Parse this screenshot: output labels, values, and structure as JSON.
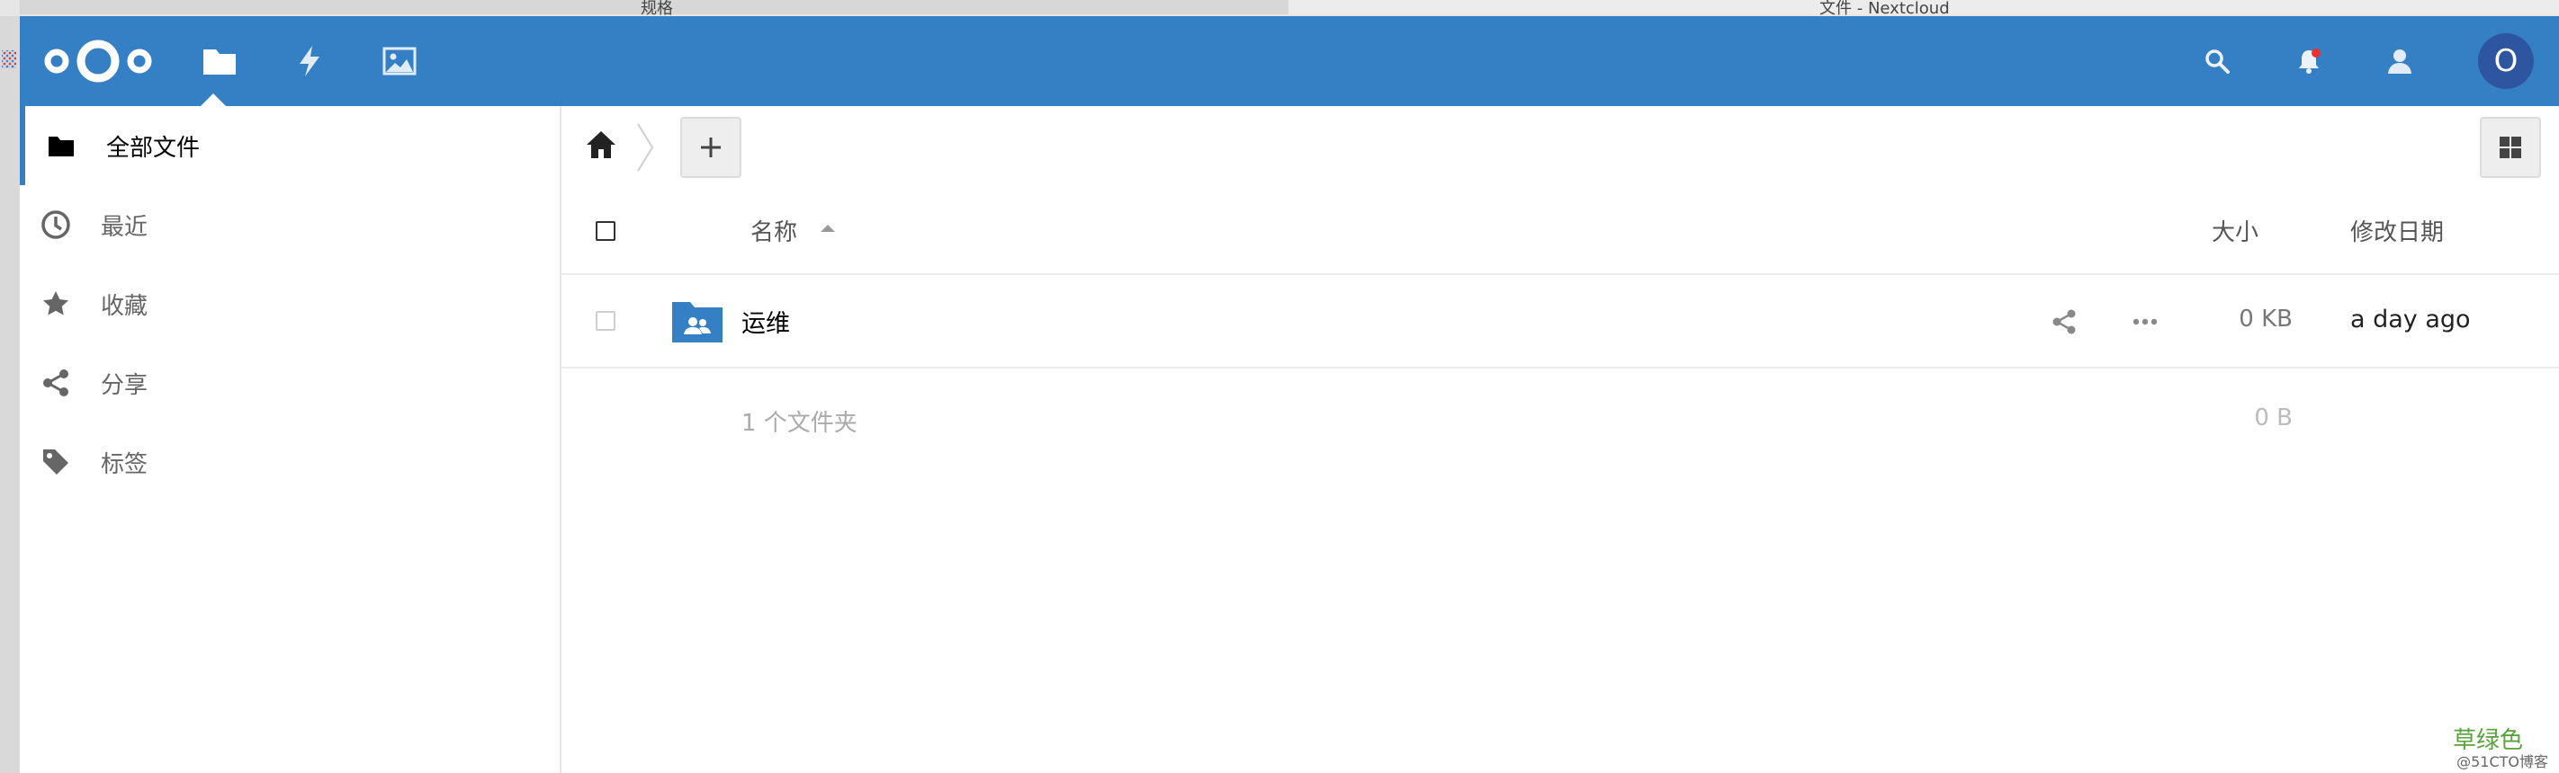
{
  "browser": {
    "tab_left_title": "规格",
    "tab_right_title": "文件 - Nextcloud"
  },
  "header": {
    "nav": [
      {
        "icon": "folder-icon",
        "label": "文件"
      },
      {
        "icon": "lightning-icon",
        "label": "活动"
      },
      {
        "icon": "image-icon",
        "label": "图片"
      }
    ],
    "avatar_letter": "O",
    "accent": "#357fc4"
  },
  "sidebar": {
    "items": [
      {
        "label": "全部文件",
        "icon": "folder-icon",
        "active": true
      },
      {
        "label": "最近",
        "icon": "clock-icon",
        "active": false
      },
      {
        "label": "收藏",
        "icon": "star-icon",
        "active": false
      },
      {
        "label": "分享",
        "icon": "share-icon",
        "active": false
      },
      {
        "label": "标签",
        "icon": "tag-icon",
        "active": false
      }
    ]
  },
  "filelist": {
    "columns": {
      "name": "名称",
      "size": "大小",
      "modified": "修改日期"
    },
    "rows": [
      {
        "name": "运维",
        "size": "0 KB",
        "modified": "a day ago",
        "type": "shared-folder"
      }
    ],
    "summary": {
      "label": "1 个文件夹",
      "size": "0 B"
    }
  },
  "watermark": {
    "text": "草绿色",
    "subtext": "@51CTO博客"
  }
}
